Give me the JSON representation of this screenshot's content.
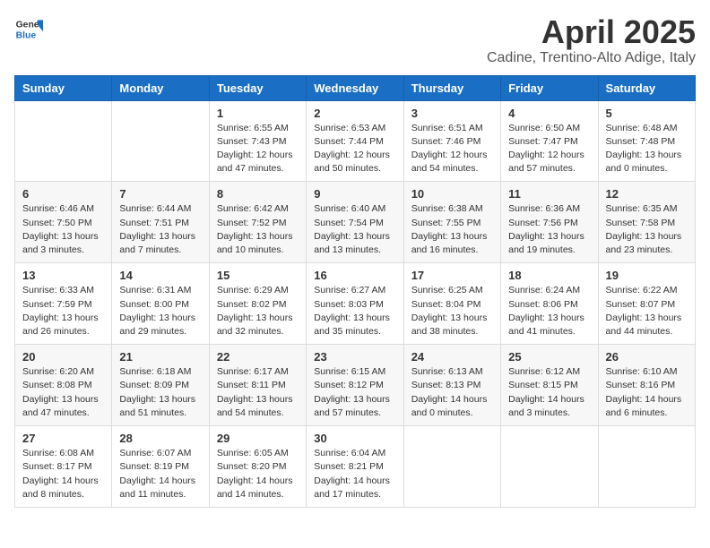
{
  "logo": {
    "line1": "General",
    "line2": "Blue"
  },
  "title": "April 2025",
  "location": "Cadine, Trentino-Alto Adige, Italy",
  "days_of_week": [
    "Sunday",
    "Monday",
    "Tuesday",
    "Wednesday",
    "Thursday",
    "Friday",
    "Saturday"
  ],
  "weeks": [
    [
      {
        "day": "",
        "info": ""
      },
      {
        "day": "",
        "info": ""
      },
      {
        "day": "1",
        "info": "Sunrise: 6:55 AM\nSunset: 7:43 PM\nDaylight: 12 hours and 47 minutes."
      },
      {
        "day": "2",
        "info": "Sunrise: 6:53 AM\nSunset: 7:44 PM\nDaylight: 12 hours and 50 minutes."
      },
      {
        "day": "3",
        "info": "Sunrise: 6:51 AM\nSunset: 7:46 PM\nDaylight: 12 hours and 54 minutes."
      },
      {
        "day": "4",
        "info": "Sunrise: 6:50 AM\nSunset: 7:47 PM\nDaylight: 12 hours and 57 minutes."
      },
      {
        "day": "5",
        "info": "Sunrise: 6:48 AM\nSunset: 7:48 PM\nDaylight: 13 hours and 0 minutes."
      }
    ],
    [
      {
        "day": "6",
        "info": "Sunrise: 6:46 AM\nSunset: 7:50 PM\nDaylight: 13 hours and 3 minutes."
      },
      {
        "day": "7",
        "info": "Sunrise: 6:44 AM\nSunset: 7:51 PM\nDaylight: 13 hours and 7 minutes."
      },
      {
        "day": "8",
        "info": "Sunrise: 6:42 AM\nSunset: 7:52 PM\nDaylight: 13 hours and 10 minutes."
      },
      {
        "day": "9",
        "info": "Sunrise: 6:40 AM\nSunset: 7:54 PM\nDaylight: 13 hours and 13 minutes."
      },
      {
        "day": "10",
        "info": "Sunrise: 6:38 AM\nSunset: 7:55 PM\nDaylight: 13 hours and 16 minutes."
      },
      {
        "day": "11",
        "info": "Sunrise: 6:36 AM\nSunset: 7:56 PM\nDaylight: 13 hours and 19 minutes."
      },
      {
        "day": "12",
        "info": "Sunrise: 6:35 AM\nSunset: 7:58 PM\nDaylight: 13 hours and 23 minutes."
      }
    ],
    [
      {
        "day": "13",
        "info": "Sunrise: 6:33 AM\nSunset: 7:59 PM\nDaylight: 13 hours and 26 minutes."
      },
      {
        "day": "14",
        "info": "Sunrise: 6:31 AM\nSunset: 8:00 PM\nDaylight: 13 hours and 29 minutes."
      },
      {
        "day": "15",
        "info": "Sunrise: 6:29 AM\nSunset: 8:02 PM\nDaylight: 13 hours and 32 minutes."
      },
      {
        "day": "16",
        "info": "Sunrise: 6:27 AM\nSunset: 8:03 PM\nDaylight: 13 hours and 35 minutes."
      },
      {
        "day": "17",
        "info": "Sunrise: 6:25 AM\nSunset: 8:04 PM\nDaylight: 13 hours and 38 minutes."
      },
      {
        "day": "18",
        "info": "Sunrise: 6:24 AM\nSunset: 8:06 PM\nDaylight: 13 hours and 41 minutes."
      },
      {
        "day": "19",
        "info": "Sunrise: 6:22 AM\nSunset: 8:07 PM\nDaylight: 13 hours and 44 minutes."
      }
    ],
    [
      {
        "day": "20",
        "info": "Sunrise: 6:20 AM\nSunset: 8:08 PM\nDaylight: 13 hours and 47 minutes."
      },
      {
        "day": "21",
        "info": "Sunrise: 6:18 AM\nSunset: 8:09 PM\nDaylight: 13 hours and 51 minutes."
      },
      {
        "day": "22",
        "info": "Sunrise: 6:17 AM\nSunset: 8:11 PM\nDaylight: 13 hours and 54 minutes."
      },
      {
        "day": "23",
        "info": "Sunrise: 6:15 AM\nSunset: 8:12 PM\nDaylight: 13 hours and 57 minutes."
      },
      {
        "day": "24",
        "info": "Sunrise: 6:13 AM\nSunset: 8:13 PM\nDaylight: 14 hours and 0 minutes."
      },
      {
        "day": "25",
        "info": "Sunrise: 6:12 AM\nSunset: 8:15 PM\nDaylight: 14 hours and 3 minutes."
      },
      {
        "day": "26",
        "info": "Sunrise: 6:10 AM\nSunset: 8:16 PM\nDaylight: 14 hours and 6 minutes."
      }
    ],
    [
      {
        "day": "27",
        "info": "Sunrise: 6:08 AM\nSunset: 8:17 PM\nDaylight: 14 hours and 8 minutes."
      },
      {
        "day": "28",
        "info": "Sunrise: 6:07 AM\nSunset: 8:19 PM\nDaylight: 14 hours and 11 minutes."
      },
      {
        "day": "29",
        "info": "Sunrise: 6:05 AM\nSunset: 8:20 PM\nDaylight: 14 hours and 14 minutes."
      },
      {
        "day": "30",
        "info": "Sunrise: 6:04 AM\nSunset: 8:21 PM\nDaylight: 14 hours and 17 minutes."
      },
      {
        "day": "",
        "info": ""
      },
      {
        "day": "",
        "info": ""
      },
      {
        "day": "",
        "info": ""
      }
    ]
  ]
}
